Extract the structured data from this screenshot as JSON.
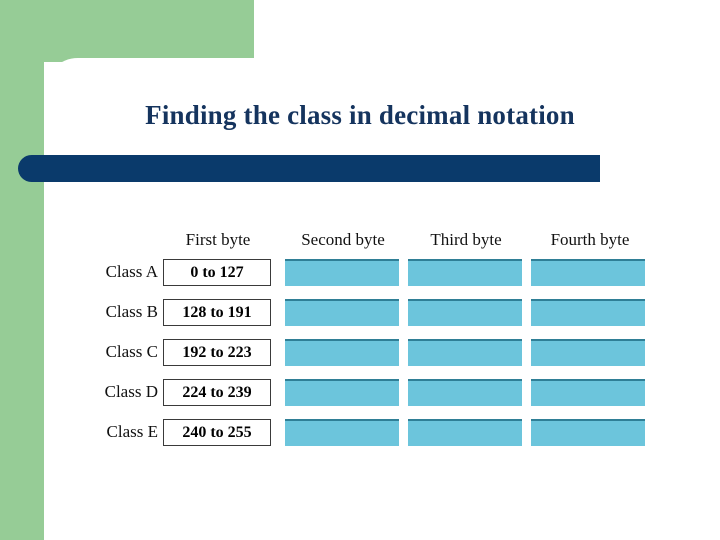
{
  "slide": {
    "title": "Finding the class in decimal notation",
    "colors": {
      "accent_green": "#96cc96",
      "title_bar_navy": "#0a3a6b",
      "title_text": "#15345e",
      "byte_cell_cyan": "#6cc5dc",
      "byte_cell_top_edge": "#2f7f96",
      "range_box_border": "#3a3a3a",
      "background": "#ffffff"
    }
  },
  "table": {
    "column_headers": [
      "First byte",
      "Second byte",
      "Third byte",
      "Fourth byte"
    ],
    "rows": [
      {
        "label": "Class A",
        "first_byte": "0 to 127"
      },
      {
        "label": "Class B",
        "first_byte": "128 to 191"
      },
      {
        "label": "Class C",
        "first_byte": "192 to 223"
      },
      {
        "label": "Class D",
        "first_byte": "224 to 239"
      },
      {
        "label": "Class E",
        "first_byte": "240 to 255"
      }
    ]
  }
}
